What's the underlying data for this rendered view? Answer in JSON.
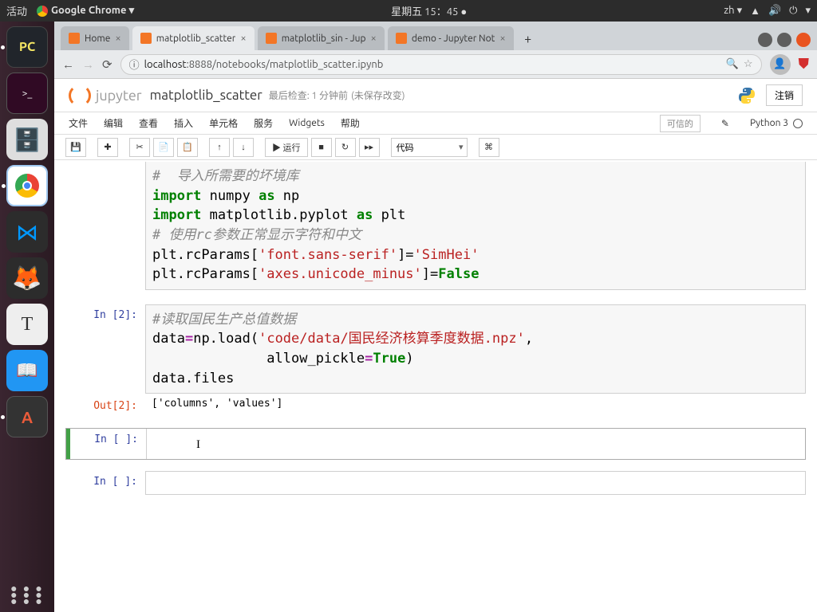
{
  "topbar": {
    "activities": "活动",
    "app": "Google Chrome ▾",
    "clock": "星期五 15：45 ●"
  },
  "launcher": {
    "pycharm": "PC",
    "text_icon": "T",
    "dict": "📖",
    "update": "A"
  },
  "tabs": [
    {
      "label": "Home"
    },
    {
      "label": "matplotlib_scatter"
    },
    {
      "label": "matplotlib_sin - Jup"
    },
    {
      "label": "demo - Jupyter Not"
    }
  ],
  "address": {
    "info": "ⓘ",
    "host": "localhost",
    "path": ":8888/notebooks/matplotlib_scatter.ipynb"
  },
  "jupyter": {
    "brand": "jupyter",
    "title": "matplotlib_scatter",
    "last_check": "最后检查: 1 分钟前",
    "unsaved": "(未保存改变)",
    "logout": "注销",
    "menu": [
      "文件",
      "编辑",
      "查看",
      "插入",
      "单元格",
      "服务",
      "Widgets",
      "帮助"
    ],
    "trusted": "可信的",
    "kernel": "Python 3",
    "run": "▶ 运行",
    "celltype": "代码"
  },
  "cells": {
    "c1": {
      "l1_cm": "#  导入所需要的坏境库",
      "l2_kw1": "import",
      "l2_nm": " numpy ",
      "l2_kw2": "as",
      "l2_as": " np",
      "l3_kw1": "import",
      "l3_nm": " matplotlib.pyplot ",
      "l3_kw2": "as",
      "l3_as": " plt",
      "l4_cm": "# 使用rc参数正常显示字符和中文",
      "l5_a": "plt.rcParams[",
      "l5_s": "'font.sans-serif'",
      "l5_b": "]=",
      "l5_s2": "'SimHei'",
      "l6_a": "plt.rcParams[",
      "l6_s": "'axes.unicode_minus'",
      "l6_b": "]=",
      "l6_v": "False"
    },
    "p2": "In [2]:",
    "c2": {
      "l1_cm": "#读取国民生产总值数据",
      "l2_a": "data",
      "l2_eq": "=",
      "l2_b": "np.load(",
      "l2_s": "'code/data/国民经济核算季度数据.npz'",
      "l2_c": ",",
      "l3_pad": "              allow_pickle",
      "l3_eq": "=",
      "l3_v": "True",
      "l3_c": ")",
      "l4": "data.files"
    },
    "o2p": "Out[2]:",
    "o2": "['columns', 'values']",
    "p3": "In [ ]:",
    "p4": "In [ ]:"
  }
}
